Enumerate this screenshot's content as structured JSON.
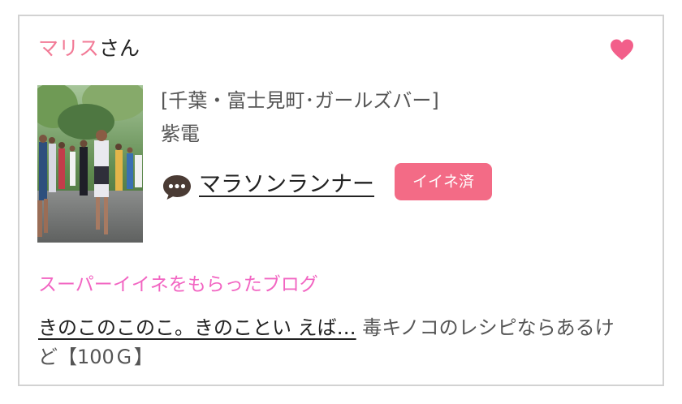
{
  "colors": {
    "accent_pink": "#f27a96",
    "heart_pink": "#f25f8a",
    "badge_pink": "#f36b86",
    "heading_pink": "#f265c2",
    "card_border": "#d2d2d2"
  },
  "user": {
    "name": "マリス",
    "suffix": "さん",
    "favorite_icon": "heart-icon"
  },
  "profile": {
    "photo_subject": "marathon-runners-photo",
    "shop": "[千葉・富士見町･ガールズバー]",
    "girl_name": "紫電"
  },
  "blog": {
    "comment_icon": "speech-bubble-icon",
    "title": "マラソンランナー",
    "like_badge": "イイネ済"
  },
  "super_like": {
    "heading": "スーパーイイネをもらったブログ",
    "post_title": "きのこのこのこ。きのことい えば…",
    "comment": "毒キノコのレシピならあるけど【100Ｇ】"
  }
}
